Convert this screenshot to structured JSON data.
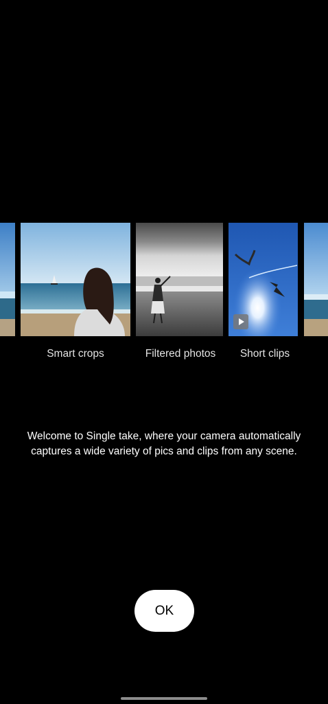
{
  "carousel": {
    "labels": {
      "smart_crops": "Smart crops",
      "filtered_photos": "Filtered photos",
      "short_clips": "Short clips"
    }
  },
  "welcome": {
    "message": "Welcome to Single take, where your camera automatically captures a wide variety of pics and clips from any scene."
  },
  "actions": {
    "ok_label": "OK"
  },
  "icons": {
    "play": "play-icon"
  },
  "colors": {
    "background": "#000000",
    "button_background": "#ffffff",
    "button_text": "#000000",
    "text": "#ffffff",
    "label_text": "#e4e4e4"
  }
}
